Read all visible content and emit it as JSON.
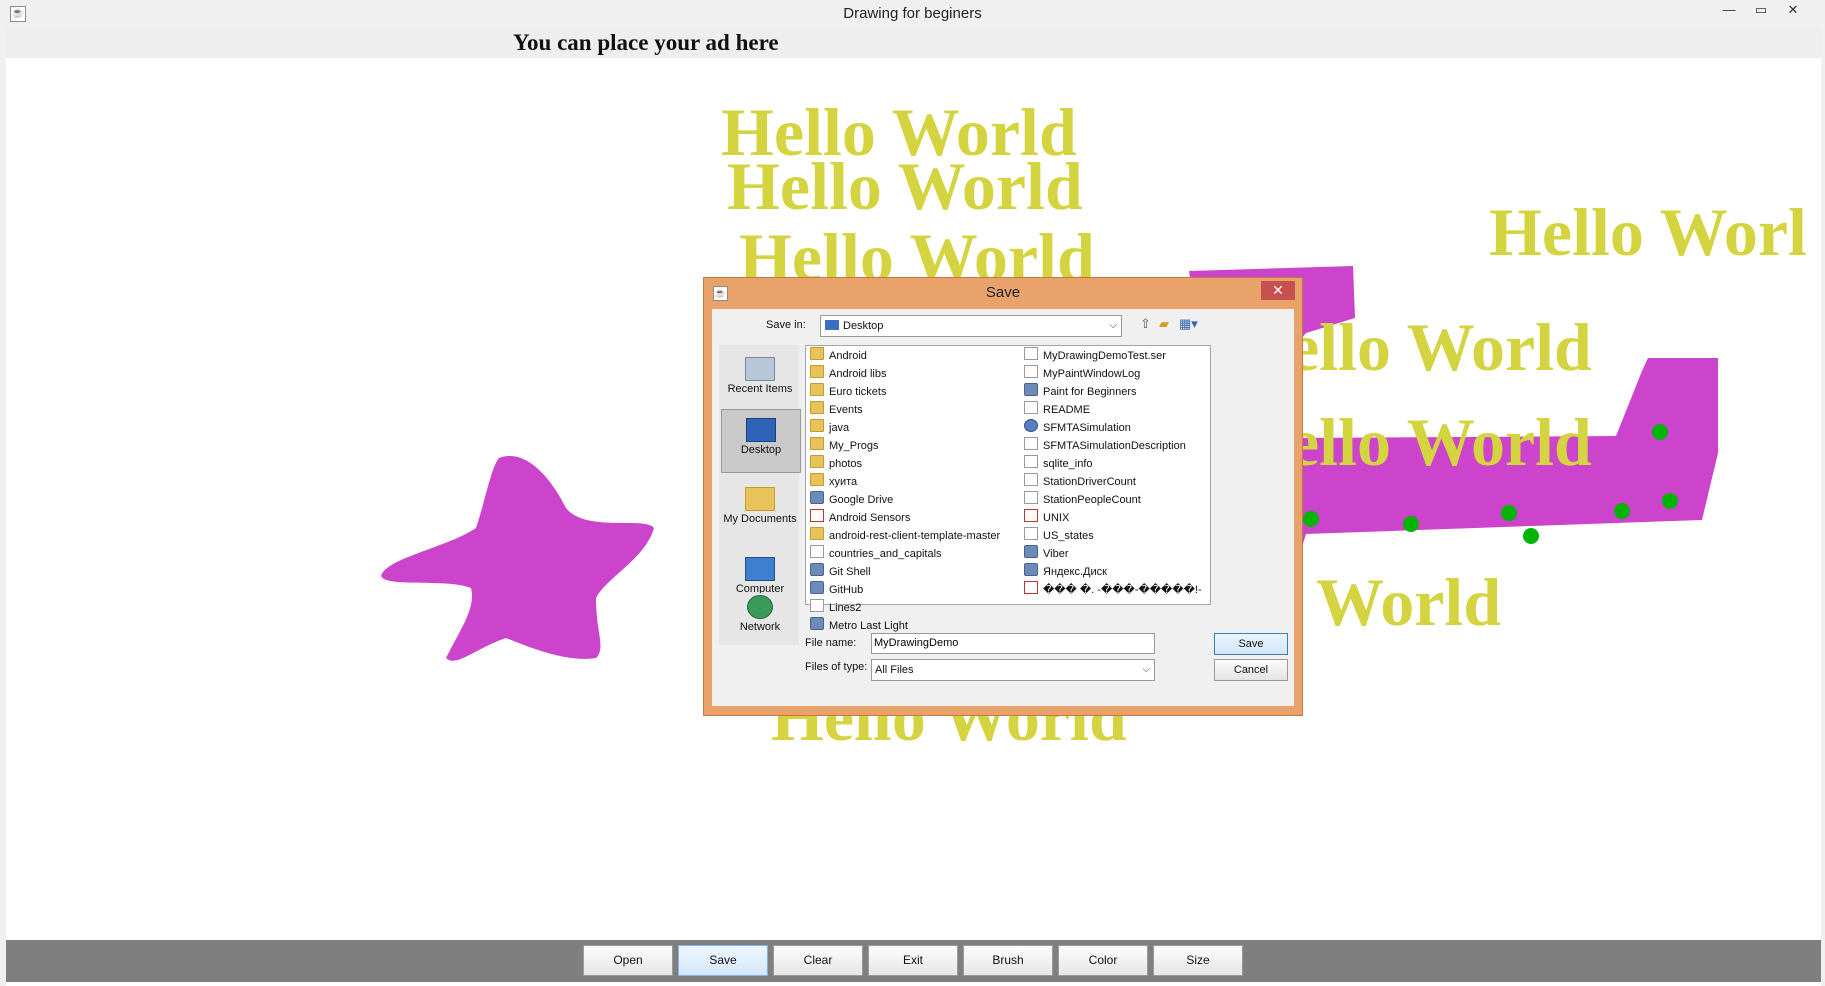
{
  "window": {
    "title": "Drawing for beginers"
  },
  "ad": {
    "text": "You can place your ad here"
  },
  "canvas": {
    "hello_text": "Hello World",
    "hello_partial_right": "Hello Worl",
    "hello_partial_a": "ello World",
    "hello_partial_b": "World",
    "text_color": "#d3d43f",
    "shape_color": "#cc44cc",
    "dot_color": "#00b400"
  },
  "toolbar": {
    "buttons": [
      "Open",
      "Save",
      "Clear",
      "Exit",
      "Brush",
      "Color",
      "Size"
    ],
    "active": "Save"
  },
  "dialog": {
    "title": "Save",
    "save_in_label": "Save in:",
    "save_in_value": "Desktop",
    "places": [
      "Recent Items",
      "Desktop",
      "My Documents",
      "Computer",
      "Network"
    ],
    "active_place": "Desktop",
    "files_col1": [
      {
        "name": "Android",
        "icon": "folder-icon"
      },
      {
        "name": "Android libs",
        "icon": "folder-icon"
      },
      {
        "name": "Euro tickets",
        "icon": "folder-icon"
      },
      {
        "name": "Events",
        "icon": "folder-icon"
      },
      {
        "name": "java",
        "icon": "folder-icon"
      },
      {
        "name": "My_Progs",
        "icon": "folder-icon"
      },
      {
        "name": "photos",
        "icon": "folder-icon"
      },
      {
        "name": "хуита",
        "icon": "folder-icon"
      },
      {
        "name": "Google Drive",
        "icon": "shortcut-icon"
      },
      {
        "name": "Android Sensors",
        "icon": "pdf-icon"
      },
      {
        "name": "android-rest-client-template-master",
        "icon": "folder-icon"
      },
      {
        "name": "countries_and_capitals",
        "icon": "file-icon"
      },
      {
        "name": "Git Shell",
        "icon": "shortcut-icon"
      },
      {
        "name": "GitHub",
        "icon": "shortcut-icon"
      },
      {
        "name": "Lines2",
        "icon": "file-icon"
      },
      {
        "name": "Metro Last Light",
        "icon": "shortcut-icon"
      }
    ],
    "files_col2": [
      {
        "name": "MyDrawingDemoTest.ser",
        "icon": "file-icon"
      },
      {
        "name": "MyPaintWindowLog",
        "icon": "file-icon"
      },
      {
        "name": "Paint for Beginners",
        "icon": "shortcut-icon"
      },
      {
        "name": "README",
        "icon": "file-icon"
      },
      {
        "name": "SFMTASimulation",
        "icon": "globe-icon"
      },
      {
        "name": "SFMTASimulationDescription",
        "icon": "file-icon"
      },
      {
        "name": "sqlite_info",
        "icon": "file-icon"
      },
      {
        "name": "StationDriverCount",
        "icon": "file-icon"
      },
      {
        "name": "StationPeopleCount",
        "icon": "file-icon"
      },
      {
        "name": "UNIX",
        "icon": "pdf-icon"
      },
      {
        "name": "US_states",
        "icon": "file-icon"
      },
      {
        "name": "Viber",
        "icon": "shortcut-icon"
      },
      {
        "name": "Яндекс.Диск",
        "icon": "shortcut-icon"
      },
      {
        "name": "��� �. -���-�����!-",
        "icon": "pdf-icon"
      }
    ],
    "file_name_label": "File name:",
    "file_name_value": "MyDrawingDemo",
    "file_type_label": "Files of type:",
    "file_type_value": "All Files",
    "save_button": "Save",
    "cancel_button": "Cancel"
  }
}
